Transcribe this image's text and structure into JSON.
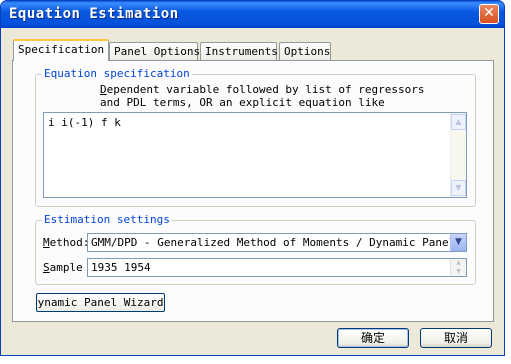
{
  "window": {
    "title": "Equation Estimation",
    "close_glyph": "✕"
  },
  "tabs": [
    {
      "label": "Specification",
      "active": true
    },
    {
      "label": "Panel Options",
      "active": false
    },
    {
      "label": "Instruments",
      "active": false
    },
    {
      "label": "Options",
      "active": false
    }
  ],
  "equation_spec": {
    "legend": "Equation specification",
    "hint_line1_first": "D",
    "hint_line1_rest": "ependent variable followed by list of regressors",
    "hint_line2": "and PDL terms, OR an explicit equation like",
    "value": "i i(-1) f k"
  },
  "estimation": {
    "legend": "Estimation settings",
    "method_label_first": "M",
    "method_label_rest": "ethod:",
    "method_value": "GMM/DPD  -  Generalized Method of Moments / Dynamic Panel Data",
    "sample_label_first": "S",
    "sample_label_rest": "ample",
    "sample_value": "1935 1954"
  },
  "wizard_button": "Dynamic Panel Wizard...",
  "buttons": {
    "ok": "确定",
    "cancel": "取消"
  },
  "icons": {
    "scroll_up": "▲",
    "scroll_down": "▼",
    "dropdown": "▼",
    "spin_up": "▲",
    "spin_down": "▼"
  }
}
